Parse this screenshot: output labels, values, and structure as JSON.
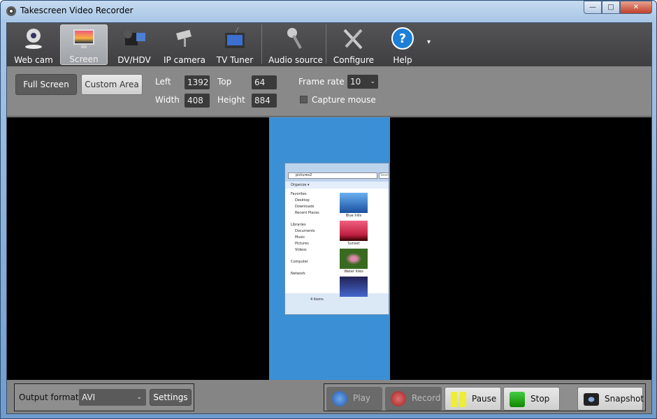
{
  "window": {
    "title": "Takescreen Video Recorder",
    "controls": [
      "—",
      "□",
      "✕"
    ]
  },
  "toolbar": {
    "items": [
      {
        "label": "Web cam",
        "icon": "webcam-icon"
      },
      {
        "label": "Screen",
        "icon": "monitor-icon",
        "active": true
      },
      {
        "label": "DV/HDV",
        "icon": "camcorder-icon"
      },
      {
        "label": "IP camera",
        "icon": "security-camera-icon"
      },
      {
        "label": "TV Tuner",
        "icon": "tv-icon"
      },
      {
        "label": "Audio source",
        "icon": "microphone-icon"
      },
      {
        "label": "Configure",
        "icon": "tools-icon"
      },
      {
        "label": "Help",
        "icon": "help-icon"
      }
    ],
    "more": "▾"
  },
  "options": {
    "full_screen": "Full Screen",
    "custom_area": "Custom Area",
    "left_label": "Left",
    "left": "1392",
    "top_label": "Top",
    "top": "64",
    "width_label": "Width",
    "width": "408",
    "height_label": "Height",
    "height": "884",
    "frame_rate_label": "Frame rate",
    "frame_rate": "10",
    "capture_mouse": "Capture mouse",
    "capture_mouse_checked": false
  },
  "preview": {
    "address": "pictures2",
    "search": "Search",
    "organize": "Organize ▾",
    "nav": [
      "Favorites",
      "Desktop",
      "Downloads",
      "Recent Places",
      "Libraries",
      "Documents",
      "Music",
      "Pictures",
      "Videos",
      "Computer",
      "Network"
    ],
    "images": [
      "Blue hills",
      "Sunset",
      "Water lilies"
    ],
    "status": "4 items"
  },
  "bottom": {
    "output_format_label": "Output format",
    "output_format": "AVI",
    "settings": "Settings",
    "play": "Play",
    "record": "Record",
    "pause": "Pause",
    "stop": "Stop",
    "snapshot": "Snapshot"
  },
  "colors": {
    "toolbar": "#48484a",
    "panel": "#8a8a8a",
    "preview_bg": "#000000",
    "capture_area": "#3b8fd4"
  }
}
